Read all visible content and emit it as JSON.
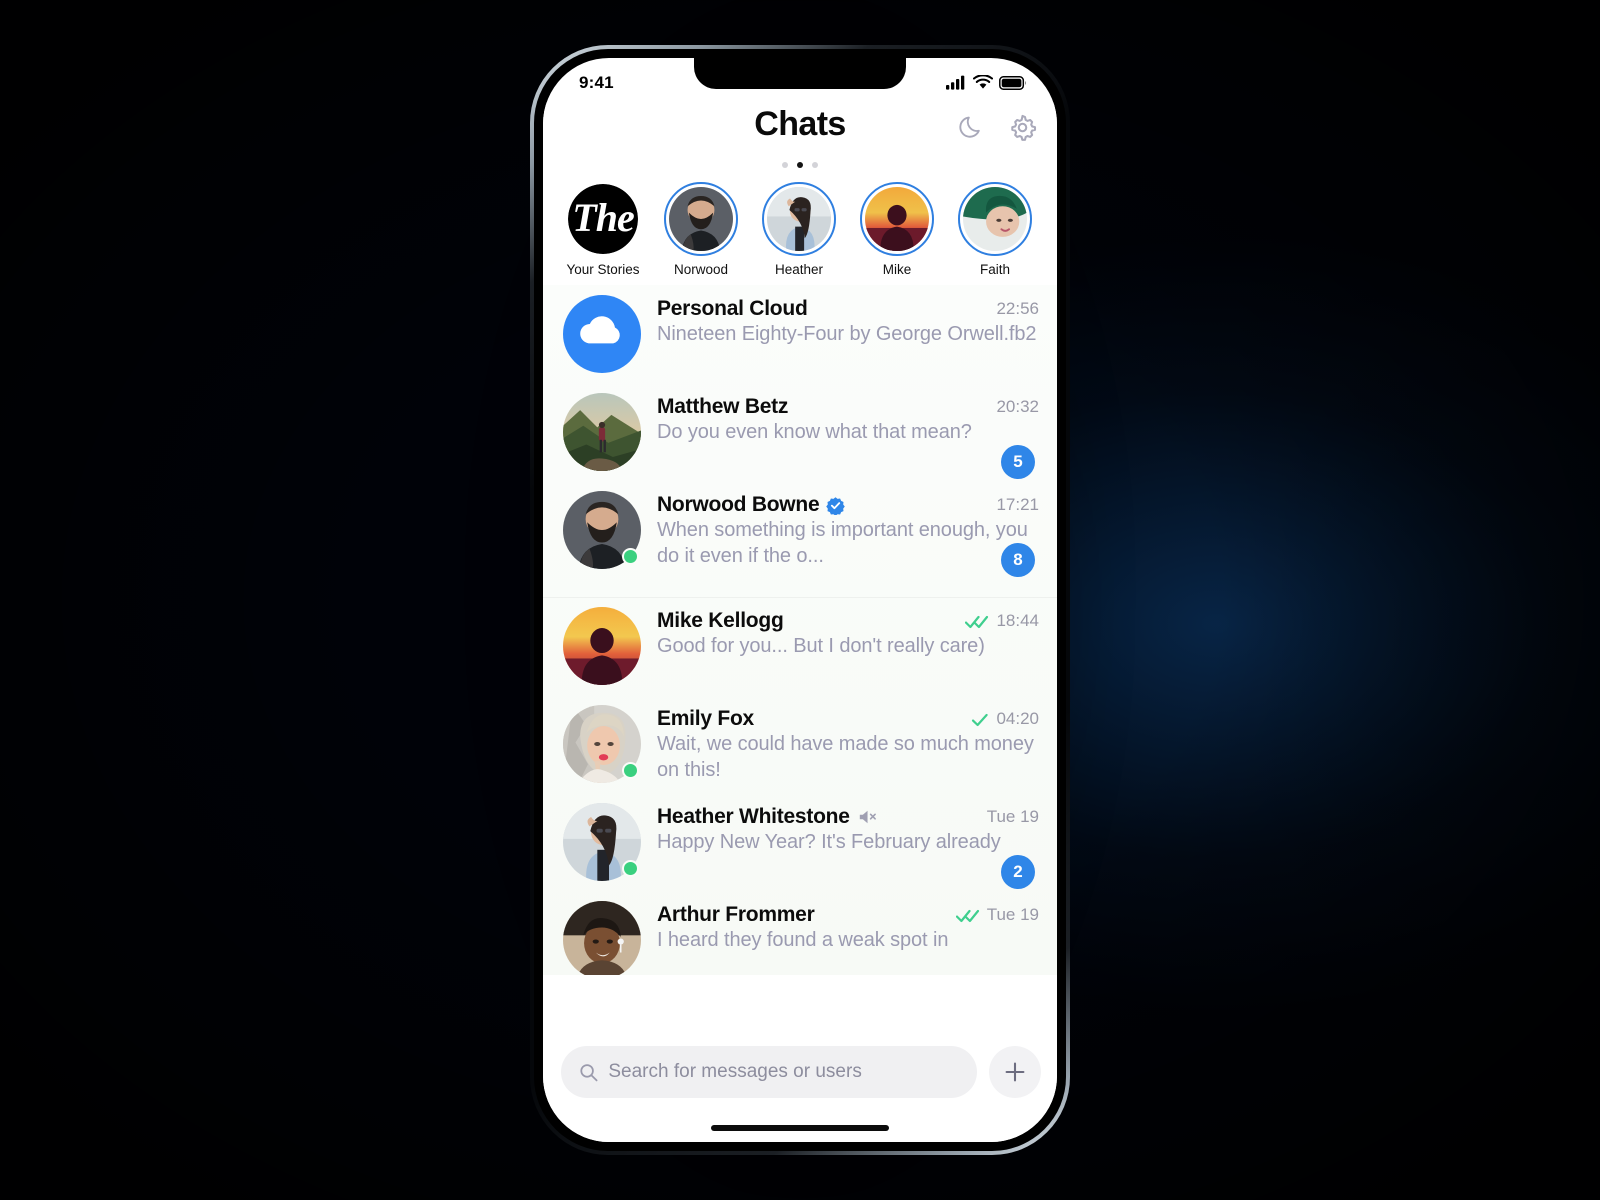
{
  "background": {
    "accent_navy": "#0b3055",
    "edge_black": "#000207"
  },
  "status_bar": {
    "time": "9:41",
    "icons": [
      "cellular-signal-icon",
      "wifi-icon",
      "battery-icon"
    ]
  },
  "header": {
    "title": "Chats",
    "night_mode_icon": "moon-icon",
    "settings_icon": "gear-icon",
    "page_dots": {
      "count": 3,
      "active_index": 1
    }
  },
  "stories": {
    "items": [
      {
        "label": "Your Stories",
        "avatar": "the-newspaper-logo",
        "ring": false,
        "logo_text": "The"
      },
      {
        "label": "Norwood",
        "avatar": "bearded-man-portrait",
        "ring": true
      },
      {
        "label": "Heather",
        "avatar": "woman-denim-jacket",
        "ring": true
      },
      {
        "label": "Mike",
        "avatar": "man-sunset-silhouette",
        "ring": true
      },
      {
        "label": "Faith",
        "avatar": "woman-green-hair",
        "ring": true
      }
    ],
    "ring_color": "#2f7fe0"
  },
  "chats": {
    "badge_color": "#2f86e8",
    "online_color": "#3ad07f",
    "read_color": "#3fcf8e",
    "items": [
      {
        "name": "Personal Cloud",
        "message": "Nineteen Eighty-Four by George Orwell.fb2",
        "time": "22:56",
        "avatar": "cloud-icon-avatar",
        "badge": null,
        "online": false,
        "verified": false,
        "muted": false,
        "receipt": null,
        "separated": false
      },
      {
        "name": "Matthew Betz",
        "message": "Do you even know what that mean?",
        "time": "20:32",
        "avatar": "hiker-mountain-photo",
        "badge": "5",
        "online": false,
        "verified": false,
        "muted": false,
        "receipt": null,
        "separated": false
      },
      {
        "name": "Norwood Bowne",
        "message": "When something is important enough, you do it even if the o...",
        "time": "17:21",
        "avatar": "bearded-man-portrait",
        "badge": "8",
        "online": true,
        "verified": true,
        "muted": false,
        "receipt": null,
        "separated": false
      },
      {
        "name": "Mike Kellogg",
        "message": "Good for you... But I don't really care)",
        "time": "18:44",
        "avatar": "man-sunset-silhouette",
        "badge": null,
        "online": false,
        "verified": false,
        "muted": false,
        "receipt": "double-check",
        "separated": true
      },
      {
        "name": "Emily Fox",
        "message": "Wait, we could have made so much money on this!",
        "time": "04:20",
        "avatar": "blonde-woman-photo",
        "badge": null,
        "online": true,
        "verified": false,
        "muted": false,
        "receipt": "single-check",
        "separated": false
      },
      {
        "name": "Heather Whitestone",
        "message": "Happy New Year? It's February already",
        "time": "Tue 19",
        "avatar": "woman-denim-jacket",
        "badge": "2",
        "online": true,
        "verified": false,
        "muted": true,
        "receipt": null,
        "separated": false
      },
      {
        "name": "Arthur Frommer",
        "message": "I heard they found a weak spot in",
        "time": "Tue 19",
        "avatar": "man-headphones-photo",
        "badge": null,
        "online": false,
        "verified": false,
        "muted": false,
        "receipt": "double-check",
        "separated": false
      }
    ]
  },
  "bottom_bar": {
    "search_placeholder": "Search for messages or users",
    "search_value": "",
    "search_icon": "search-icon",
    "new_chat_icon": "plus-icon"
  }
}
